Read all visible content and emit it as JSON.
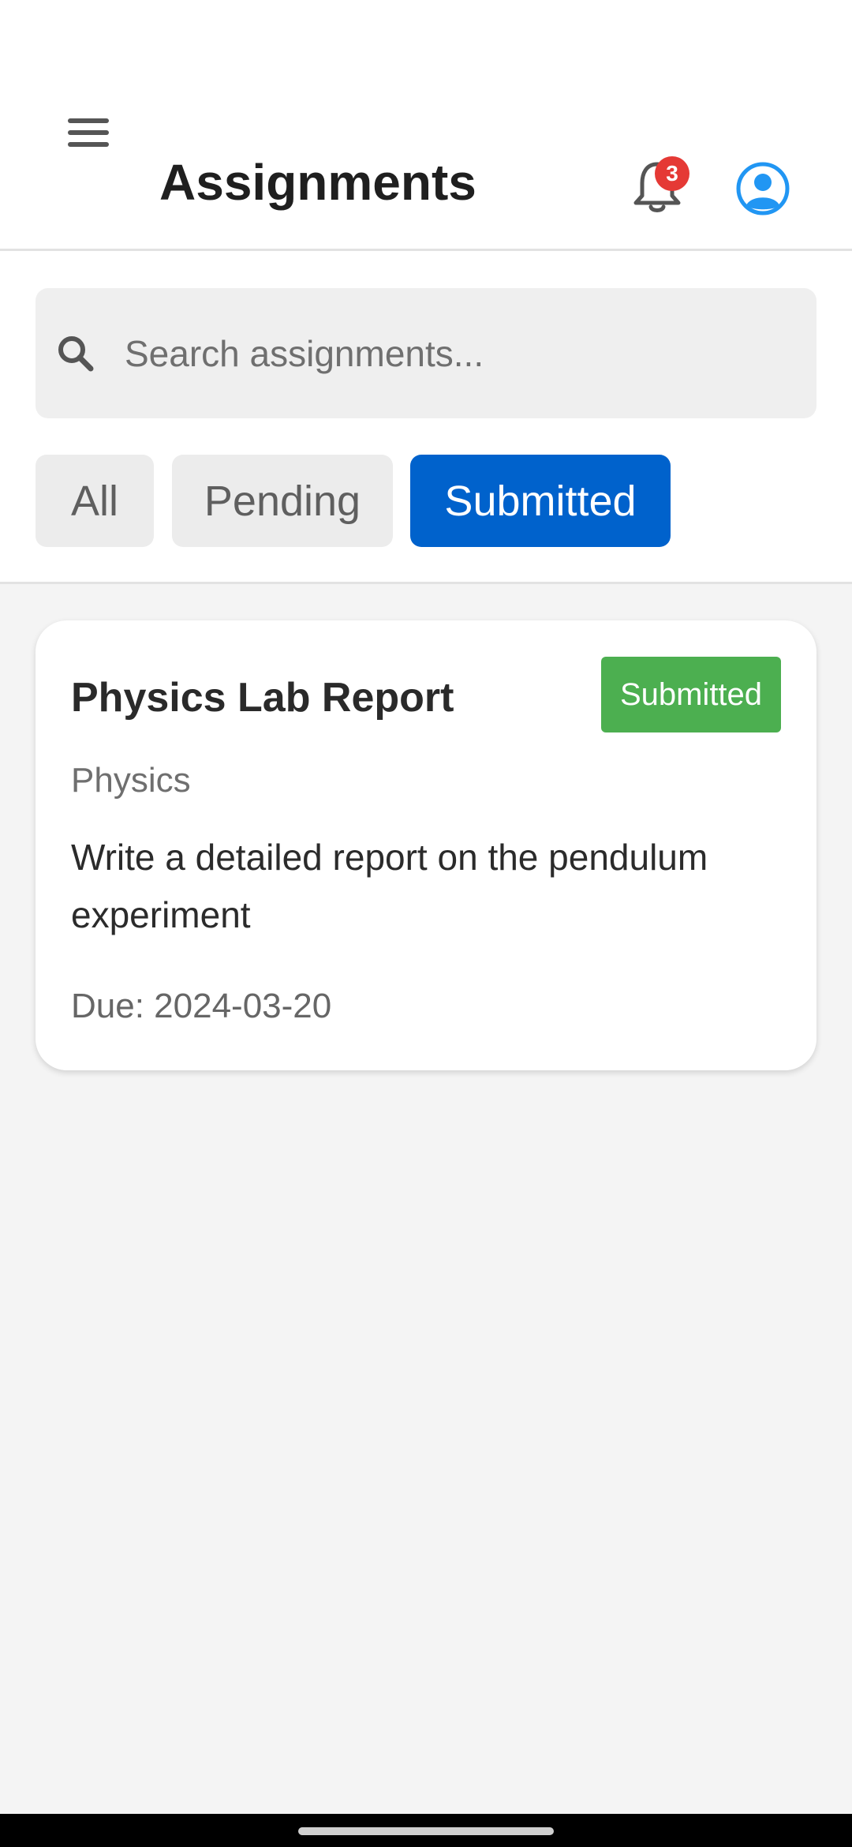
{
  "header": {
    "title": "Assignments",
    "notification_count": "3"
  },
  "icons": {
    "menu": "hamburger-menu-icon",
    "notifications": "bell-icon",
    "profile": "account-circle-icon",
    "search": "search-icon"
  },
  "search": {
    "placeholder": "Search assignments...",
    "value": ""
  },
  "filters": {
    "selected": "Submitted",
    "items": [
      {
        "label": "All"
      },
      {
        "label": "Pending"
      },
      {
        "label": "Submitted"
      }
    ]
  },
  "assignments": [
    {
      "title": "Physics Lab Report",
      "status": "Submitted",
      "subject": "Physics",
      "description": "Write a detailed report on the pendulum experiment",
      "due": "Due: 2024-03-20"
    }
  ],
  "colors": {
    "accent": "#0062cc",
    "status_submitted": "#4caf50",
    "badge": "#e53935",
    "profile_icon": "#2196f3"
  }
}
